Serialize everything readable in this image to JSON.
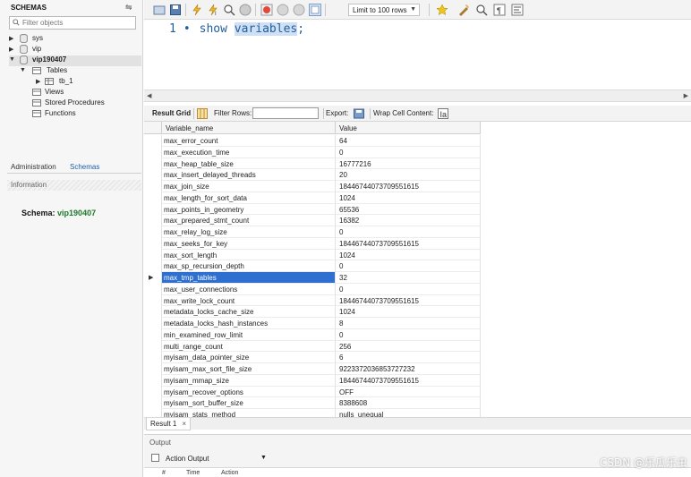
{
  "sidebar": {
    "title": "SCHEMAS",
    "filter_placeholder": "Filter objects",
    "schemas": [
      {
        "name": "sys",
        "expanded": false
      },
      {
        "name": "vip",
        "expanded": false
      },
      {
        "name": "vip190407",
        "expanded": true
      }
    ],
    "vip190407_children": {
      "tables_label": "Tables",
      "table_name": "tb_1",
      "views_label": "Views",
      "procs_label": "Stored Procedures",
      "funcs_label": "Functions"
    },
    "tabs": [
      "Administration",
      "Schemas"
    ],
    "info_label": "Information",
    "schema_label": "Schema:",
    "schema_value": "vip190407"
  },
  "toolbar": {
    "limit_label": "Limit to 100 rows"
  },
  "editor": {
    "line_number": "1",
    "keyword": "show",
    "word": "variables",
    "suffix": ";"
  },
  "result_bar": {
    "grid_label": "Result Grid",
    "filter_label": "Filter Rows:",
    "export_label": "Export:",
    "wrap_label": "Wrap Cell Content:"
  },
  "grid": {
    "columns": [
      "Variable_name",
      "Value"
    ],
    "rows": [
      {
        "name": "max_error_count",
        "value": "64"
      },
      {
        "name": "max_execution_time",
        "value": "0"
      },
      {
        "name": "max_heap_table_size",
        "value": "16777216"
      },
      {
        "name": "max_insert_delayed_threads",
        "value": "20"
      },
      {
        "name": "max_join_size",
        "value": "18446744073709551615"
      },
      {
        "name": "max_length_for_sort_data",
        "value": "1024"
      },
      {
        "name": "max_points_in_geometry",
        "value": "65536"
      },
      {
        "name": "max_prepared_stmt_count",
        "value": "16382"
      },
      {
        "name": "max_relay_log_size",
        "value": "0"
      },
      {
        "name": "max_seeks_for_key",
        "value": "18446744073709551615"
      },
      {
        "name": "max_sort_length",
        "value": "1024"
      },
      {
        "name": "max_sp_recursion_depth",
        "value": "0"
      },
      {
        "name": "max_tmp_tables",
        "value": "32"
      },
      {
        "name": "max_user_connections",
        "value": "0"
      },
      {
        "name": "max_write_lock_count",
        "value": "18446744073709551615"
      },
      {
        "name": "metadata_locks_cache_size",
        "value": "1024"
      },
      {
        "name": "metadata_locks_hash_instances",
        "value": "8"
      },
      {
        "name": "min_examined_row_limit",
        "value": "0"
      },
      {
        "name": "multi_range_count",
        "value": "256"
      },
      {
        "name": "myisam_data_pointer_size",
        "value": "6"
      },
      {
        "name": "myisam_max_sort_file_size",
        "value": "9223372036853727232"
      },
      {
        "name": "myisam_mmap_size",
        "value": "18446744073709551615"
      },
      {
        "name": "myisam_recover_options",
        "value": "OFF"
      },
      {
        "name": "myisam_sort_buffer_size",
        "value": "8388608"
      },
      {
        "name": "myisam_stats_method",
        "value": "nulls_unequal"
      }
    ],
    "selected_index": 12
  },
  "result_tab": {
    "label": "Result 1",
    "close": "×"
  },
  "output": {
    "title": "Output",
    "selector": "Action Output",
    "columns": [
      "#",
      "Time",
      "Action"
    ]
  },
  "watermark": "CSDN @乐瓜乐虫"
}
